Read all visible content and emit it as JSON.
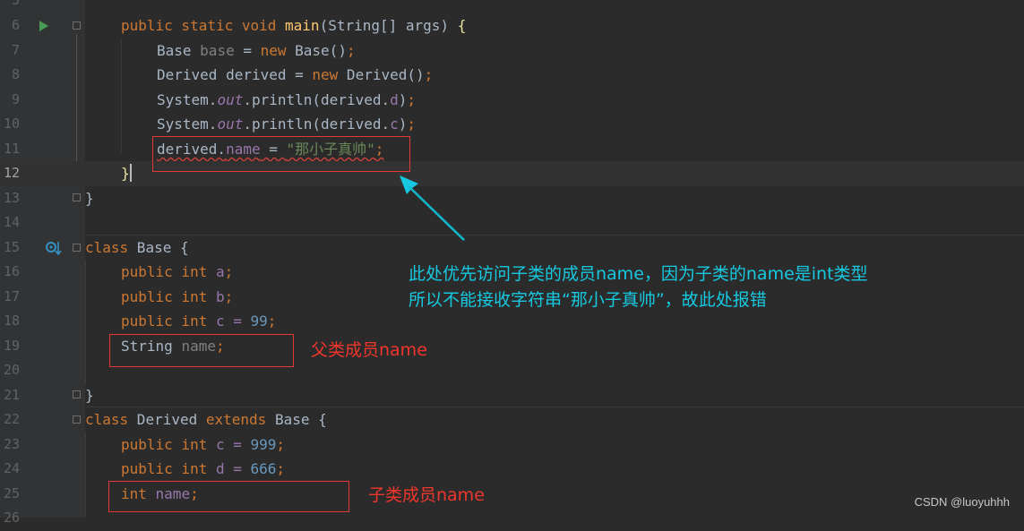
{
  "editor": {
    "line_numbers": [
      "5",
      "6",
      "7",
      "8",
      "9",
      "10",
      "11",
      "12",
      "13",
      "14",
      "15",
      "16",
      "17",
      "18",
      "19",
      "20",
      "21",
      "22",
      "23",
      "24",
      "25",
      "26"
    ],
    "current_line": "12"
  },
  "code": {
    "main_sig": {
      "mods": "public static void ",
      "name": "main",
      "params": "(String[] args) ",
      "brace": "{"
    },
    "l7": {
      "type": "Base ",
      "var": "base",
      "eq": " = ",
      "new": "new",
      "rest": " Base()",
      "semi": ";"
    },
    "l8": {
      "type": "Derived derived = ",
      "new": "new",
      "rest": " Derived()",
      "semi": ";"
    },
    "l9": {
      "pre": "System.",
      "out": "out",
      "mid": ".println(derived.",
      "fld": "d",
      "end": ")",
      "semi": ";"
    },
    "l10": {
      "pre": "System.",
      "out": "out",
      "mid": ".println(derived.",
      "fld": "c",
      "end": ")",
      "semi": ";"
    },
    "l11": {
      "obj": "derived.",
      "fld": "name",
      "eq": " = ",
      "str": "\"那小子真帅\"",
      "semi": ";"
    },
    "l12": {
      "brace": "}"
    },
    "l13": {
      "brace": "}"
    },
    "l15": {
      "kw": "class",
      "rest": " Base {"
    },
    "l16": {
      "kw": "public int",
      "rest": " a",
      "semi": ";"
    },
    "l17": {
      "kw": "public int",
      "rest": " b",
      "semi": ";"
    },
    "l18": {
      "kw": "public int",
      "rest": " c = ",
      "num": "99",
      "semi": ";"
    },
    "l19": {
      "type": "String ",
      "fld": "name",
      "semi": ";"
    },
    "l21": {
      "brace": "}"
    },
    "l22": {
      "kw": "class",
      "mid": " Derived ",
      "kw2": "extends",
      "rest": " Base {"
    },
    "l23": {
      "kw": "public int",
      "rest": " c = ",
      "num": "999",
      "semi": ";"
    },
    "l24": {
      "kw": "public int",
      "rest": " d = ",
      "num": "666",
      "semi": ";"
    },
    "l25": {
      "kw": "int",
      "fld": " name",
      "semi": ";"
    }
  },
  "annotations": {
    "explain_line1": "此处优先访问子类的成员name，因为子类的name是int类型",
    "explain_line2": "所以不能接收字符串“那小子真帅”，故此处报错",
    "parent_member": "父类成员name",
    "child_member": "子类成员name"
  },
  "watermark": "CSDN @luoyuhhh",
  "colors": {
    "background": "#2b2b2b",
    "keyword": "#cc7832",
    "annotation_cyan": "#16c9e0",
    "annotation_red": "#f0362c"
  }
}
